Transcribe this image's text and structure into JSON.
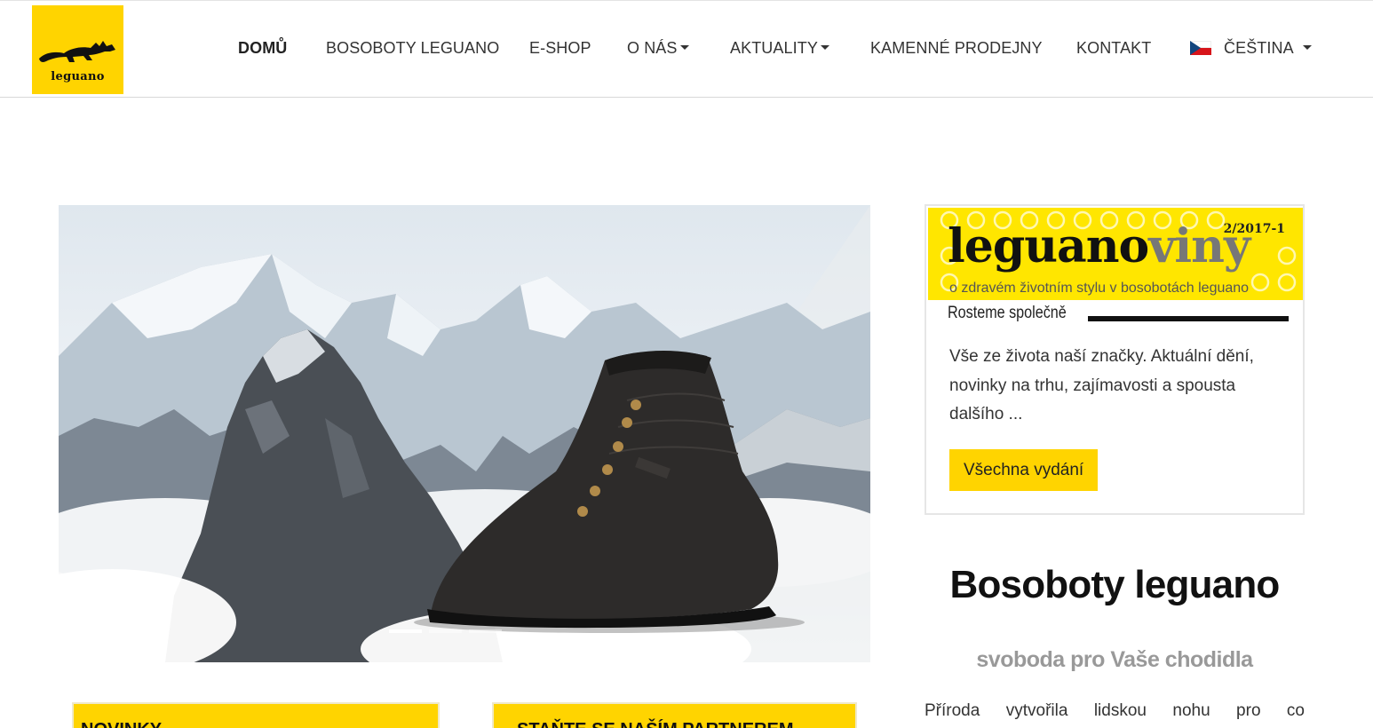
{
  "logo": {
    "text": "leguano"
  },
  "nav": {
    "items": [
      {
        "label": "DOMŮ",
        "active": true
      },
      {
        "label": "BOSOBOTY LEGUANO"
      },
      {
        "label": "E-SHOP"
      },
      {
        "label": "O NÁS",
        "dropdown": true
      },
      {
        "label": "AKTUALITY",
        "dropdown": true
      },
      {
        "label": "KAMENNÉ PRODEJNY"
      },
      {
        "label": "KONTAKT"
      },
      {
        "label": "ČEŠTINA",
        "dropdown": true,
        "icon": "czech-flag-icon"
      }
    ]
  },
  "hero": {
    "image": "mountain-landscape-with-barefoot-boot",
    "slides": 3,
    "active_slide": 1
  },
  "newsletter": {
    "magazine_title": "leguanoviny",
    "magazine_title_main": "leguano",
    "magazine_title_suffix": "viny",
    "issue": "2/2017-1",
    "subtitle": "o zdravém životním stylu v bosobotách leguano",
    "headline": "Rosteme společně",
    "text": "Vše ze života naší značky. Aktuální dění, novinky na trhu, zajímavosti a spousta dalšího ...",
    "button": "Všechna vydání"
  },
  "section": {
    "title": "Bosoboty leguano",
    "subtitle": "svoboda pro Vaše chodidla",
    "body_start": "Příroda vytvořila lidskou nohu pro co"
  },
  "boxes": [
    {
      "label": "NOVINKY"
    },
    {
      "label": "STAŇTE SE NAŠÍM PARTNEREM"
    }
  ],
  "colors": {
    "brand_yellow": "#ffd400",
    "text": "#333333",
    "muted": "#999999"
  }
}
